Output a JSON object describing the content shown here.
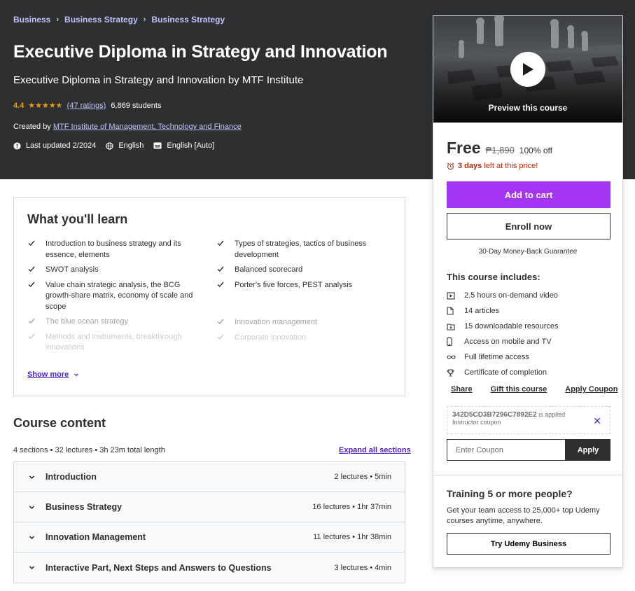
{
  "breadcrumb": [
    "Business",
    "Business Strategy",
    "Business Strategy"
  ],
  "course": {
    "title": "Executive Diploma in Strategy and Innovation",
    "subtitle": "Executive Diploma in Strategy and Innovation by MTF Institute",
    "rating": "4.4",
    "stars": 4.4,
    "ratings_count": "(47 ratings)",
    "students": "6,869 students",
    "created_by_label": "Created by",
    "author": "MTF Institute of Management, Technology and Finance",
    "last_updated": "Last updated 2/2024",
    "language": "English",
    "captions": "English [Auto]"
  },
  "sidebar": {
    "preview_label": "Preview this course",
    "price": "Free",
    "original_price": "₱1,890",
    "discount": "100% off",
    "timer_prefix": "",
    "timer_bold": "3 days",
    "timer_suffix": "left at this price!",
    "add_to_cart": "Add to cart",
    "enroll_now": "Enroll now",
    "guarantee": "30-Day Money-Back Guarantee",
    "includes_title": "This course includes:",
    "includes": [
      {
        "icon": "video-icon",
        "text": "2.5 hours on-demand video"
      },
      {
        "icon": "file-icon",
        "text": "14 articles"
      },
      {
        "icon": "download-icon",
        "text": "15 downloadable resources"
      },
      {
        "icon": "mobile-icon",
        "text": "Access on mobile and TV"
      },
      {
        "icon": "infinity-icon",
        "text": "Full lifetime access"
      },
      {
        "icon": "trophy-icon",
        "text": "Certificate of completion"
      }
    ],
    "links": [
      "Share",
      "Gift this course",
      "Apply Coupon"
    ],
    "coupon_code": "342D5CD3B7296C7892E2",
    "coupon_applied": "is applied",
    "coupon_type": "Instructor coupon",
    "coupon_placeholder": "Enter Coupon",
    "coupon_apply": "Apply",
    "team_title": "Training 5 or more people?",
    "team_text": "Get your team access to 25,000+ top Udemy courses anytime, anywhere.",
    "team_button": "Try Udemy Business"
  },
  "learn": {
    "title": "What you'll learn",
    "left": [
      "Introduction to business strategy and its essence, elements",
      "SWOT analysis",
      "Value chain strategic analysis, the BCG growth-share matrix, economy of scale and scope",
      "The blue ocean strategy",
      "Methods and instruments, breakthrough innovations"
    ],
    "right": [
      "Types of strategies, tactics of business development",
      "Balanced scorecard",
      "Porter's five forces, PEST analysis",
      "Innovation management",
      "Corporate innovation"
    ],
    "show_more": "Show more"
  },
  "content": {
    "title": "Course content",
    "meta": "4 sections • 32 lectures • 3h 23m total length",
    "expand_all": "Expand all sections",
    "sections": [
      {
        "name": "Introduction",
        "info": "2 lectures • 5min"
      },
      {
        "name": "Business Strategy",
        "info": "16 lectures • 1hr 37min"
      },
      {
        "name": "Innovation Management",
        "info": "11 lectures • 1hr 38min"
      },
      {
        "name": "Interactive Part, Next Steps and Answers to Questions",
        "info": "3 lectures • 4min"
      }
    ]
  },
  "colors": {
    "header_bg": "#2d2f31",
    "accent_purple": "#a435f0",
    "link_purple": "#5022c3",
    "star": "#f69c08",
    "timer_red": "#b32d0f"
  }
}
